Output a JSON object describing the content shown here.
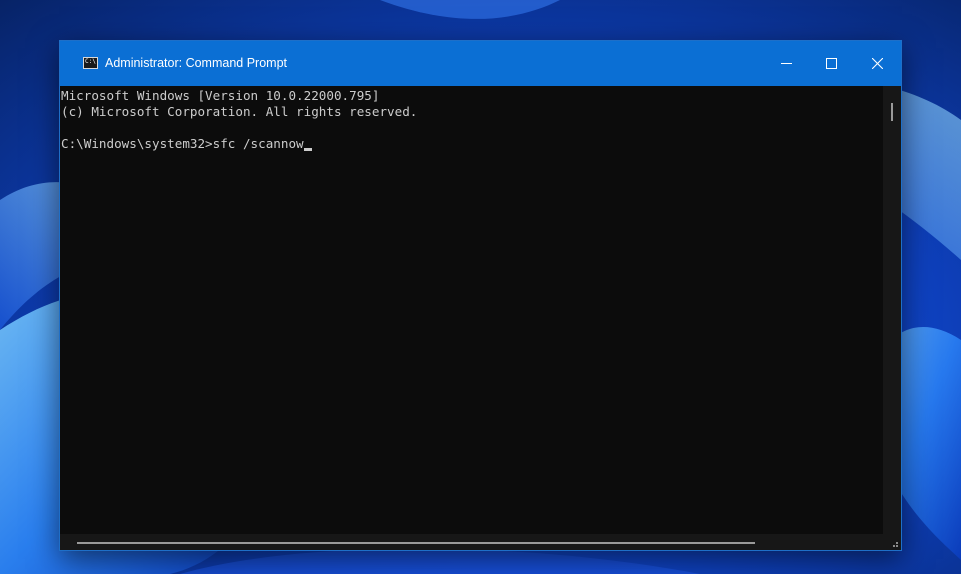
{
  "window": {
    "title": "Administrator: Command Prompt",
    "icon": "cmd-icon",
    "icon_glyph": "C:\\",
    "controls": {
      "minimize": "minimize-icon",
      "maximize": "maximize-icon",
      "close": "close-icon"
    }
  },
  "console": {
    "lines": [
      "Microsoft Windows [Version 10.0.22000.795]",
      "(c) Microsoft Corporation. All rights reserved.",
      "",
      "C:\\Windows\\system32>sfc /scannow"
    ]
  },
  "colors": {
    "titlebar": "#0b6fd4",
    "console_background": "#0c0c0c",
    "console_text": "#cccccc",
    "wallpaper": "#0a2a8a"
  }
}
